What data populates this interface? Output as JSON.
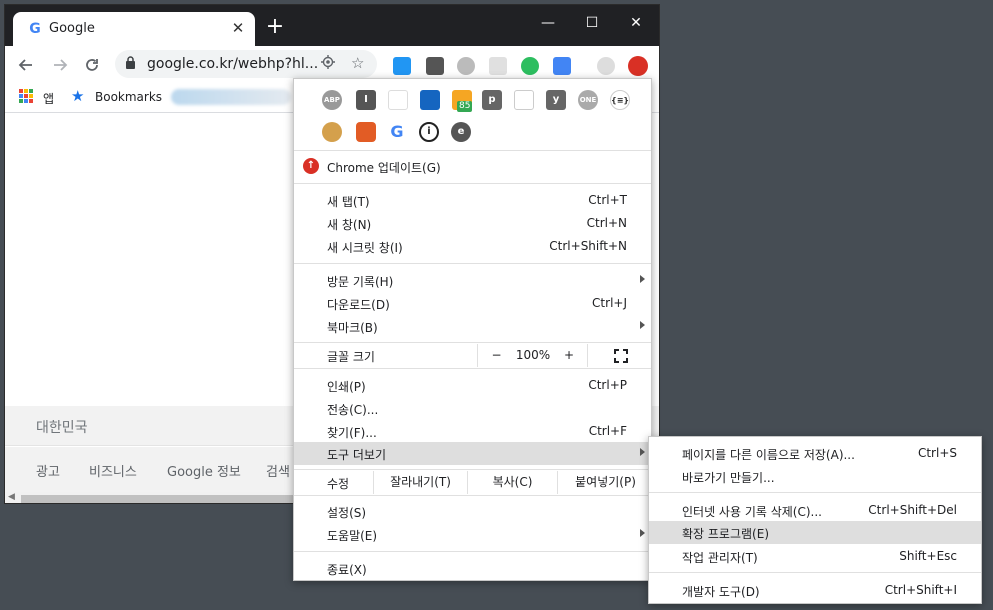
{
  "browser": {
    "tab_title": "Google",
    "tab_favicon": "G",
    "close_glyph": "✕",
    "new_tab_glyph": "+",
    "window_controls": {
      "minimize": "—",
      "maximize": "☐",
      "close": "✕"
    },
    "url": "google.co.kr/webhp?hl...",
    "icons": [
      "back-icon",
      "forward-icon",
      "reload-icon",
      "lock-icon",
      "location-icon",
      "star-icon",
      "profile-icon",
      "update-icon"
    ]
  },
  "bookmarks_bar": {
    "apps_label": "앱",
    "bookmarks_label": "Bookmarks"
  },
  "page": {
    "country": "대한민국",
    "footer_links": [
      "광고",
      "비즈니스",
      "Google 정보",
      "검색"
    ]
  },
  "menu": {
    "extension_badge": "85",
    "extension_icons": [
      "abp-icon",
      "instapaper-icon",
      "extension-2-icon",
      "extension-3-icon",
      "extension-badge-icon",
      "pocket-p-icon",
      "screenshot-icon",
      "y-icon",
      "one-icon",
      "json-icon",
      "cookie-icon",
      "brave-icon",
      "google-icon",
      "info-icon",
      "e-icon"
    ],
    "update": "Chrome 업데이트(G)",
    "new_tab": {
      "label": "새 탭(T)",
      "shortcut": "Ctrl+T"
    },
    "new_window": {
      "label": "새 창(N)",
      "shortcut": "Ctrl+N"
    },
    "new_incognito": {
      "label": "새 시크릿 창(I)",
      "shortcut": "Ctrl+Shift+N"
    },
    "history": {
      "label": "방문 기록(H)"
    },
    "downloads": {
      "label": "다운로드(D)",
      "shortcut": "Ctrl+J"
    },
    "bookmarks": {
      "label": "북마크(B)"
    },
    "zoom": {
      "label": "글꼴 크기",
      "minus": "−",
      "value": "100%",
      "plus": "+"
    },
    "print": {
      "label": "인쇄(P)",
      "shortcut": "Ctrl+P"
    },
    "cast": {
      "label": "전송(C)..."
    },
    "find": {
      "label": "찾기(F)...",
      "shortcut": "Ctrl+F"
    },
    "more_tools": {
      "label": "도구 더보기"
    },
    "edit": {
      "label": "수정",
      "cut": "잘라내기(T)",
      "copy": "복사(C)",
      "paste": "붙여넣기(P)"
    },
    "settings": {
      "label": "설정(S)"
    },
    "help": {
      "label": "도움말(E)"
    },
    "exit": {
      "label": "종료(X)"
    }
  },
  "submenu": {
    "save_page": {
      "label": "페이지를 다른 이름으로 저장(A)...",
      "shortcut": "Ctrl+S"
    },
    "create_shortcut": {
      "label": "바로가기 만들기..."
    },
    "clear_data": {
      "label": "인터넷 사용 기록 삭제(C)...",
      "shortcut": "Ctrl+Shift+Del"
    },
    "extensions": {
      "label": "확장 프로그램(E)"
    },
    "task_manager": {
      "label": "작업 관리자(T)",
      "shortcut": "Shift+Esc"
    },
    "dev_tools": {
      "label": "개발자 도구(D)",
      "shortcut": "Ctrl+Shift+I"
    }
  },
  "colors": {
    "titlebar": "#202124",
    "background": "#464d54",
    "highlight": "#dedede",
    "update_red": "#d93025"
  }
}
